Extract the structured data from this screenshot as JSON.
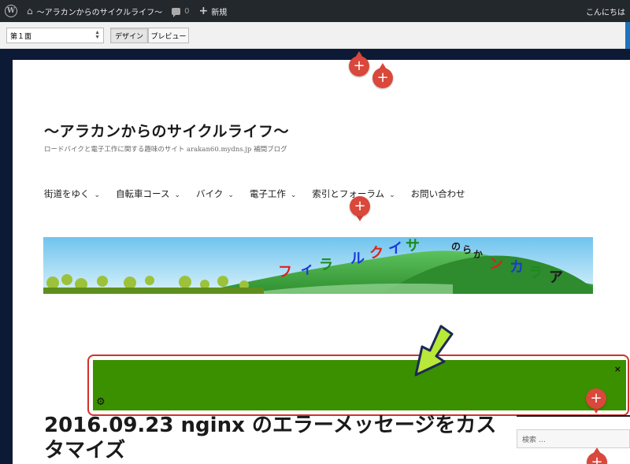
{
  "adminbar": {
    "site_name": "〜アラカンからのサイクルライフ〜",
    "comment_count": "0",
    "new_label": "新規",
    "greeting": "こんにちは"
  },
  "toolbar": {
    "page_select_value": "第１面",
    "tab_design": "デザイン",
    "tab_preview": "プレビュー"
  },
  "site": {
    "title": "〜アラカンからのサイクルライフ〜",
    "description": "ロードバイクと電子工作に関する趣味のサイト arakan60.mydns.jp 補間ブログ"
  },
  "nav": {
    "items": [
      {
        "label": "街道をゆく",
        "caret": "⌄"
      },
      {
        "label": "自転車コース",
        "caret": "⌄"
      },
      {
        "label": "バイク",
        "caret": "⌄"
      },
      {
        "label": "電子工作",
        "caret": "⌄"
      },
      {
        "label": "索引とフォーラム",
        "caret": "⌄"
      },
      {
        "label": "お問い合わせ",
        "caret": ""
      }
    ]
  },
  "banner": {
    "letters": [
      "フ",
      "ィ",
      "ラ",
      "ル",
      "ク",
      "イ",
      "サ",
      "の",
      "ら",
      "か",
      "ン",
      "カ",
      "ラ",
      "ア"
    ],
    "colors": {
      "red": "#e0201a",
      "blue": "#1a3ad8",
      "green": "#1d8a1d",
      "sky": "#8fd3f5",
      "hill": "#3aa53a"
    }
  },
  "widget": {
    "close_glyph": "×",
    "gear_glyph": "⚙"
  },
  "post": {
    "title": "2016.09.23 nginx のエラーメッセージをカスタマイズ"
  },
  "sidebar": {
    "search_placeholder": "検索 …"
  },
  "pins": {
    "glyph": "+"
  },
  "accent_color": "#d9483b",
  "widget_color": "#3b9000",
  "arrow_color": "#b8e838"
}
